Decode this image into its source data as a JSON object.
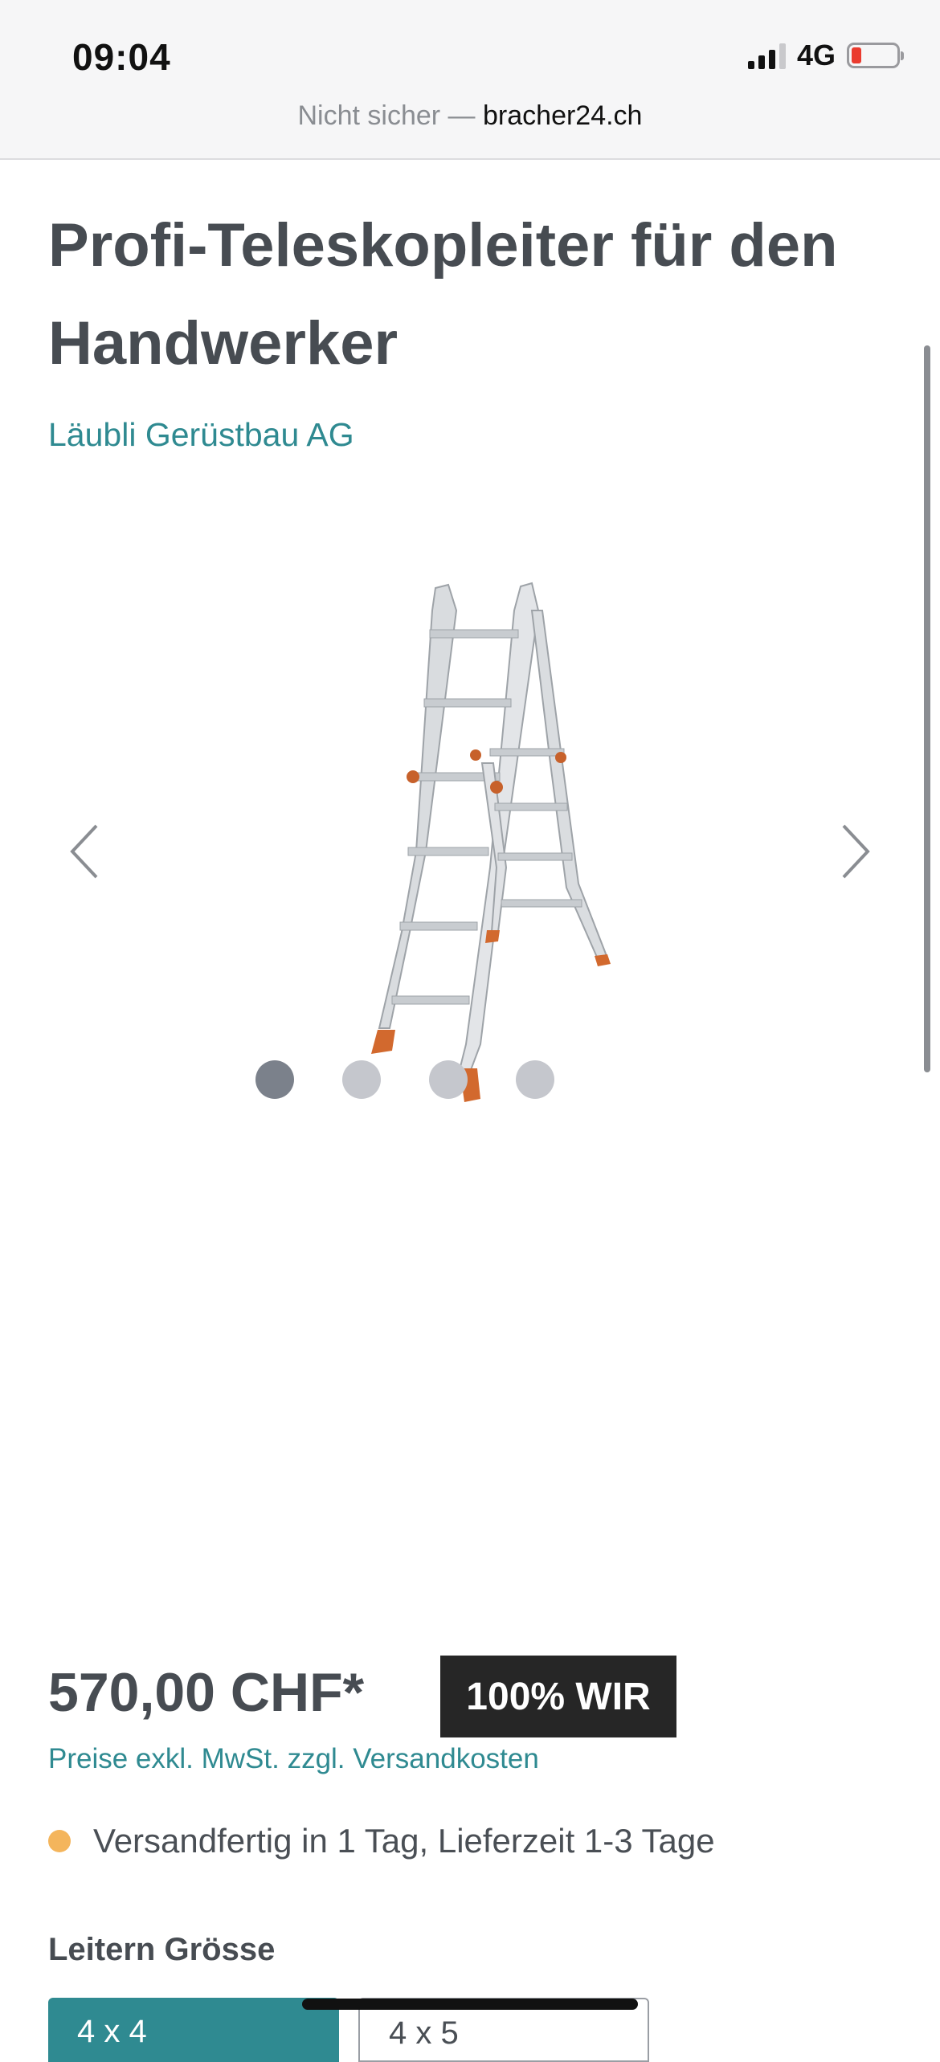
{
  "status_bar": {
    "time": "09:04",
    "network": "4G",
    "icons": [
      "signal-icon",
      "battery-icon"
    ]
  },
  "url_bar": {
    "insecure_label": "Nicht sicher —",
    "domain": "bracher24.ch"
  },
  "product": {
    "title": "Profi-Teleskopleiter für den Handwerker",
    "manufacturer": "Läubli Gerüstbau AG",
    "gallery": {
      "image": "ladder-image",
      "slides": 4,
      "active_slide": 1
    },
    "price": "570,00 CHF*",
    "badge": "100% WIR",
    "tax_note": "Preise exkl. MwSt. zzgl. Versandkosten",
    "delivery": "Versandfertig in 1 Tag, Lieferzeit 1-3 Tage",
    "size_label": "Leitern Grösse",
    "size_options": [
      {
        "label": "4 x 4",
        "selected": true
      },
      {
        "label": "4 x 5",
        "selected": false
      }
    ]
  },
  "colors": {
    "accent": "#2f8a91",
    "badge_bg": "#262626",
    "delivery_dot": "#f4b55c"
  }
}
